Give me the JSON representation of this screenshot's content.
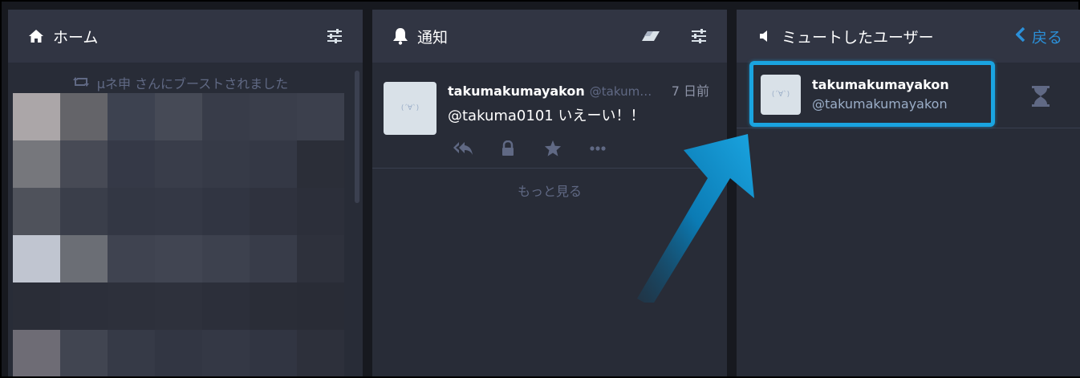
{
  "home": {
    "title": "ホーム",
    "boost_text": "μネ申 さんにブーストされました"
  },
  "notifications": {
    "title": "通知",
    "status": {
      "display_name": "takumakumayakon",
      "acct": "@takum…",
      "time": "7 日前",
      "content": "@takuma0101 いえーい！！",
      "avatar_text": "(´∀`)"
    },
    "load_more": "もっと見る"
  },
  "muted": {
    "title": "ミュートしたユーザー",
    "back_label": "戻る",
    "user": {
      "display_name": "takumakumayakon",
      "acct": "@takumakumayakon",
      "avatar_text": "(´∀`)"
    }
  },
  "colors": {
    "background": "#17191f",
    "column": "#282c37",
    "header": "#313543",
    "accent": "#2b90d9",
    "highlight": "#1aa4e0"
  },
  "icons": [
    "home-icon",
    "filter-sliders-icon",
    "bell-icon",
    "eraser-icon",
    "volume-off-icon",
    "chevron-left-icon",
    "retweet-icon",
    "reply-all-icon",
    "lock-icon",
    "star-icon",
    "ellipsis-icon",
    "hourglass-icon"
  ]
}
